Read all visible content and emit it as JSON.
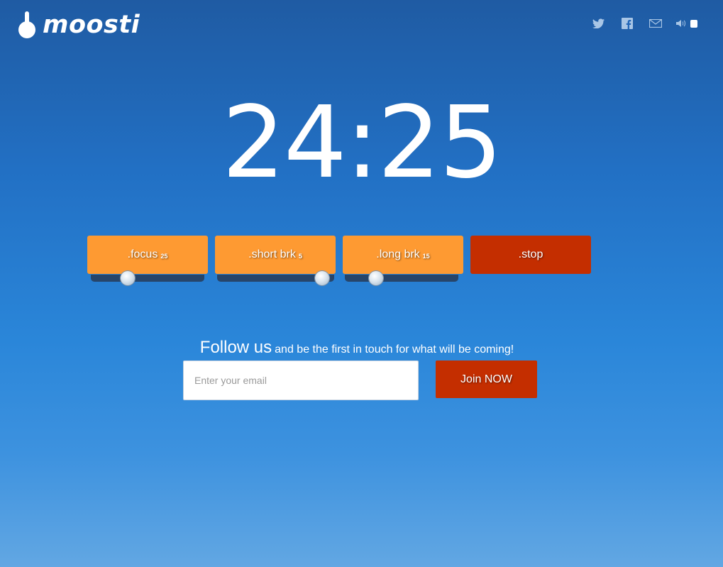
{
  "brand": {
    "name": "moosti"
  },
  "social": {
    "icons": [
      "twitter-icon",
      "facebook-icon",
      "mail-icon",
      "speaker-icon"
    ]
  },
  "timer": {
    "display": "24:25"
  },
  "modes": [
    {
      "label": ".focus",
      "minutes": "25",
      "color": "#fe9a32",
      "slider_fraction": 0.3
    },
    {
      "label": ".short brk",
      "minutes": "5",
      "color": "#fe9a32",
      "slider_fraction": 0.95
    },
    {
      "label": ".long brk",
      "minutes": "15",
      "color": "#fe9a32",
      "slider_fraction": 0.24
    },
    {
      "label": ".stop",
      "color": "#c42e00"
    }
  ],
  "signup": {
    "headline": "Follow us",
    "subline": "and be the first in touch for what will be coming!",
    "email_placeholder": "Enter your email",
    "button_label": "Join NOW"
  },
  "colors": {
    "accent_orange": "#fe9a32",
    "accent_red": "#c42e00",
    "slider_track": "#27456a"
  }
}
